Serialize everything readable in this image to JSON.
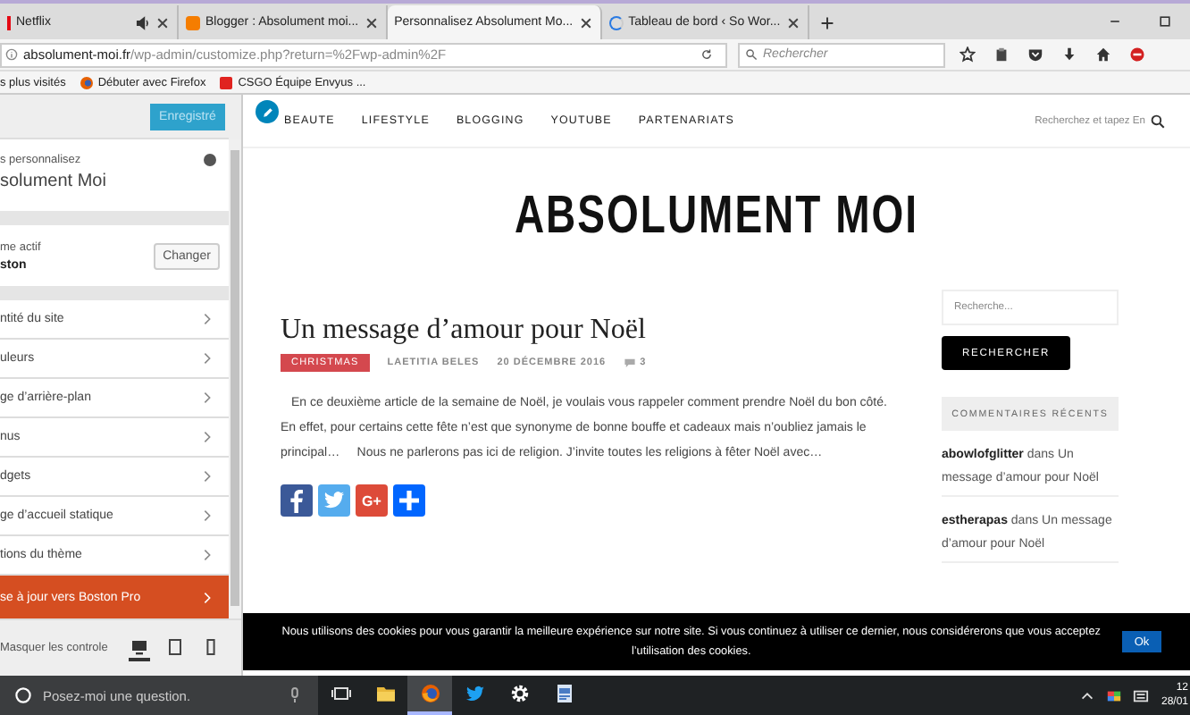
{
  "browser": {
    "tabs": [
      {
        "title": "Netflix",
        "selected": false,
        "audio": true
      },
      {
        "title": "Blogger : Absolument moi...",
        "selected": false,
        "audio": false
      },
      {
        "title": "Personnalisez Absolument Mo...",
        "selected": true,
        "audio": false
      },
      {
        "title": "Tableau de bord ‹ So Wor...",
        "selected": false,
        "audio": false
      }
    ],
    "url": {
      "domain": "absolument-moi.fr",
      "path": "/wp-admin/customize.php?return=%2Fwp-admin%2F"
    },
    "search_placeholder": "Rechercher",
    "bookmarks": [
      "s plus visités",
      "Débuter avec Firefox",
      "CSGO Équipe Envyus ..."
    ]
  },
  "customizer": {
    "save_button": "Enregistré",
    "intro": {
      "label": "s personnalisez",
      "title": "solument Moi"
    },
    "theme": {
      "label": "me actif",
      "name": "ston",
      "button": "Changer"
    },
    "sections": [
      {
        "label": "ntité du site",
        "kind": "normal"
      },
      {
        "label": "uleurs",
        "kind": "normal"
      },
      {
        "label": "ge d’arrière-plan",
        "kind": "normal"
      },
      {
        "label": "nus",
        "kind": "normal"
      },
      {
        "label": "dgets",
        "kind": "normal"
      },
      {
        "label": "ge d’accueil statique",
        "kind": "normal"
      },
      {
        "label": "tions du thème",
        "kind": "normal"
      },
      {
        "label": "se à jour vers Boston Pro",
        "kind": "upgrade"
      }
    ],
    "footer": {
      "hide_label": "Masquer les controle",
      "devices": [
        {
          "kind": "desktop",
          "selected": true
        },
        {
          "kind": "tablet",
          "selected": false
        },
        {
          "kind": "mobile",
          "selected": false
        }
      ]
    }
  },
  "site": {
    "nav": [
      "BEAUTE",
      "LIFESTYLE",
      "BLOGGING",
      "YOUTUBE",
      "PARTENARIATS"
    ],
    "search_placeholder": "Recherchez et tapez En",
    "title": "ABSOLUMENT MOI",
    "post": {
      "title": "Un message d’amour pour Noël",
      "category": "CHRISTMAS",
      "author": "LAETITIA BELES",
      "date": "20 DÉCEMBRE 2016",
      "comments": "3",
      "excerpt": "En ce deuxième article de la semaine de Noël, je voulais vous rappeler comment prendre Noël du bon côté. En effet, pour certains cette fête n’est que synonyme de bonne bouffe et cadeaux mais n’oubliez jamais le principal…     Nous ne parlerons pas ici de religion. J’invite toutes les religions à fêter Noël avec…",
      "share": [
        {
          "kind": "facebook"
        },
        {
          "kind": "twitter"
        },
        {
          "kind": "google",
          "label": "G+"
        },
        {
          "kind": "more"
        }
      ]
    },
    "widget": {
      "search_placeholder": "Recherche...",
      "search_button": "RECHERCHER",
      "heading": "COMMENTAIRES RÉCENTS",
      "comments": [
        {
          "author": "abowlofglitter",
          "text": "dans Un message d’amour pour Noël"
        },
        {
          "author": "estherapas",
          "text": "dans Un message d’amour pour Noël"
        }
      ]
    }
  },
  "cookie": {
    "text": "Nous utilisons des cookies pour vous garantir la meilleure expérience sur notre site. Si vous continuez à utiliser ce dernier, nous considérerons que vous acceptez l’utilisation des cookies.",
    "button": "Ok"
  },
  "taskbar": {
    "search_placeholder": "Posez-moi une question.",
    "apps": [
      {
        "kind": "taskview",
        "active": false
      },
      {
        "kind": "folder",
        "active": false
      },
      {
        "kind": "firefox",
        "active": true
      },
      {
        "kind": "twitter",
        "active": false
      },
      {
        "kind": "settings",
        "active": false
      },
      {
        "kind": "app",
        "active": false
      }
    ],
    "clock": {
      "time": "12",
      "date": "28/01"
    }
  }
}
